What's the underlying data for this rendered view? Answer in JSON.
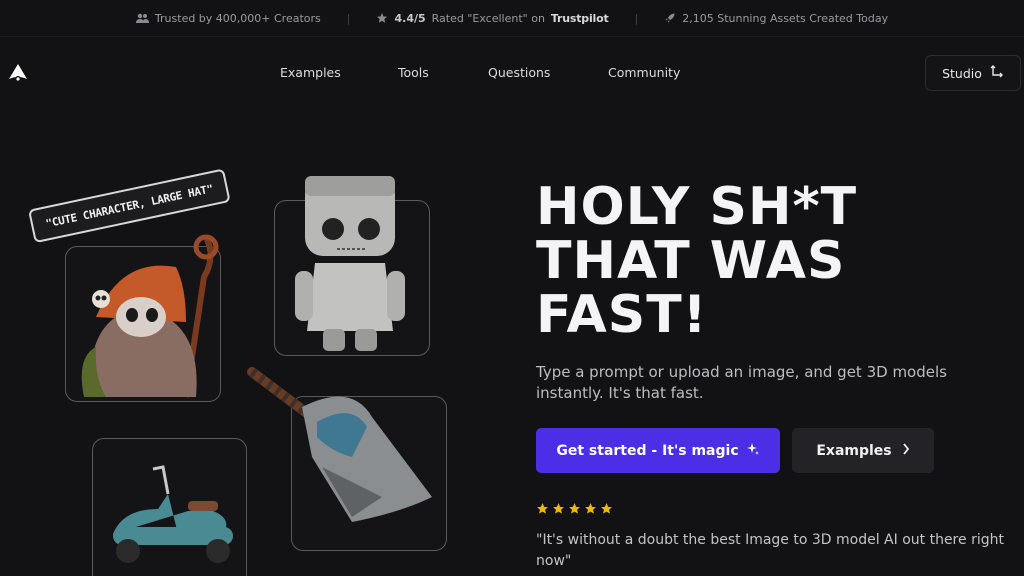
{
  "trust_bar": {
    "creators": "Trusted by 400,000+ Creators",
    "rating": "4.4/5",
    "rated_text": "Rated \"Excellent\" on",
    "trustpilot": "Trustpilot",
    "assets": "2,105 Stunning Assets Created Today"
  },
  "nav": {
    "links": [
      "Examples",
      "Tools",
      "Questions",
      "Community"
    ],
    "studio_label": "Studio"
  },
  "hero": {
    "title_line1": "HOLY SH*T",
    "title_line2": "THAT WAS",
    "title_line3": "FAST!",
    "subtitle": "Type a prompt or upload an image, and get 3D models instantly. It's that fast.",
    "cta_primary": "Get started - It's magic",
    "cta_secondary": "Examples",
    "star_rating": 5,
    "quote": "\"It's without a doubt the best Image to 3D model AI out there right now\""
  },
  "gallery": {
    "prompt_tag": "\"CUTE CHARACTER, LARGE HAT\""
  },
  "colors": {
    "background": "#121214",
    "accent": "#4b2ee6",
    "star": "#f5b800"
  },
  "icons": [
    "users-icon",
    "star-icon",
    "rocket-icon",
    "logo-icon",
    "studio-route-icon",
    "sparkle-icon",
    "chevron-right-icon"
  ]
}
